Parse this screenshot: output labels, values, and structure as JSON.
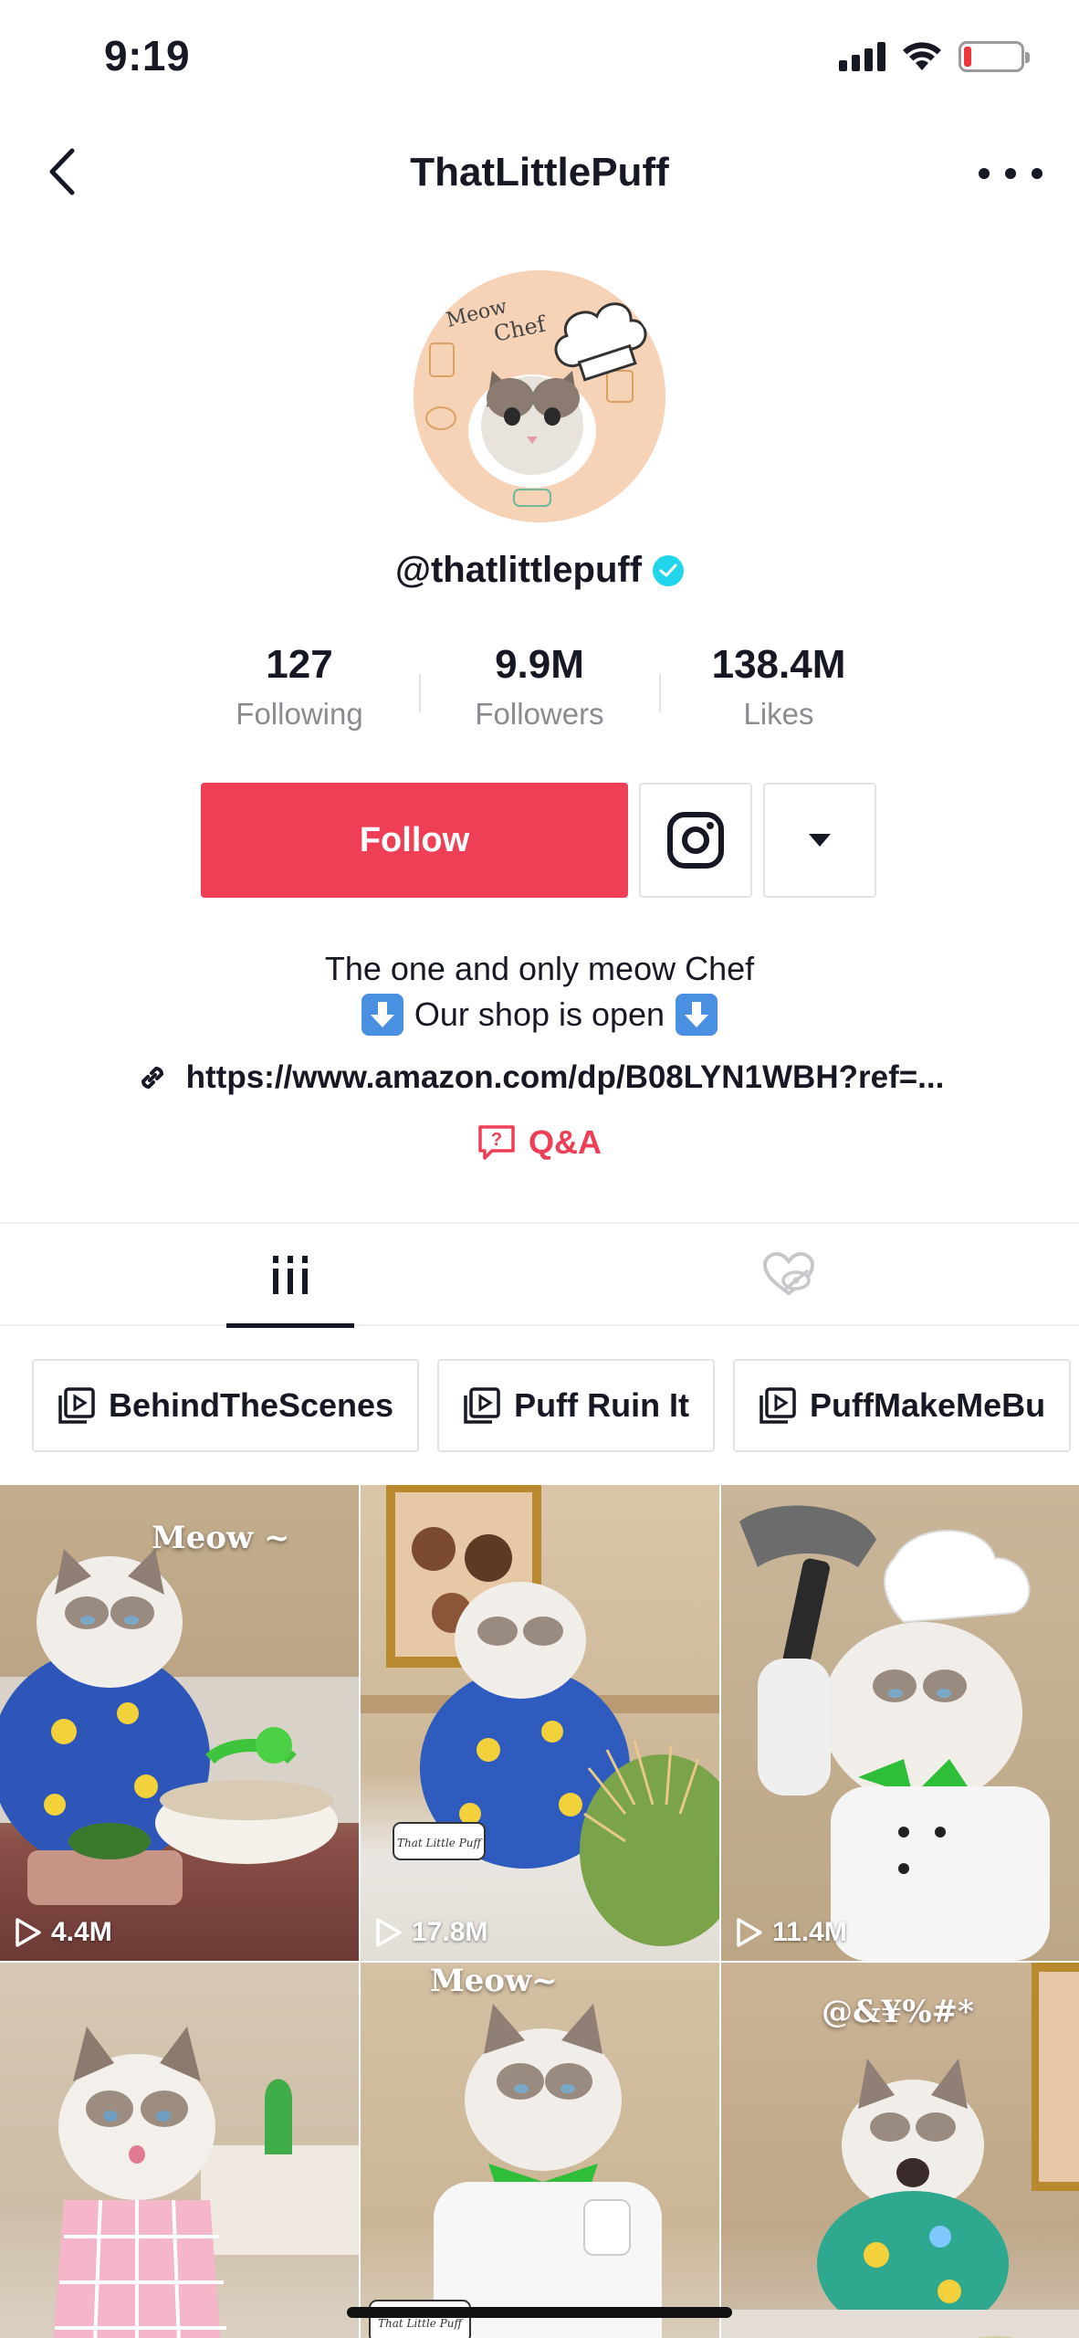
{
  "status_bar": {
    "time": "9:19",
    "battery_color": "#f0363d"
  },
  "header": {
    "title": "ThatLittlePuff",
    "back_icon": "chevron-left-icon",
    "more_icon": "more-dots-icon"
  },
  "profile": {
    "handle": "@thatlittlepuff",
    "verified": true,
    "avatar_lettering": "Meow Chef",
    "stats": [
      {
        "value": "127",
        "label": "Following"
      },
      {
        "value": "9.9M",
        "label": "Followers"
      },
      {
        "value": "138.4M",
        "label": "Likes"
      }
    ]
  },
  "actions": {
    "follow_label": "Follow",
    "follow_color": "#ee3f57",
    "instagram_icon": "instagram-icon",
    "dropdown_icon": "caret-down-icon"
  },
  "bio": {
    "line1": "The one and only meow Chef",
    "line2": "Our shop is open",
    "link": "https://www.amazon.com/dp/B08LYN1WBH?ref=...",
    "qa_label": "Q&A"
  },
  "tabs": [
    {
      "icon": "grid-icon",
      "active": true
    },
    {
      "icon": "liked-hidden-icon",
      "active": false
    }
  ],
  "playlists": [
    {
      "label": "BehindTheScenes"
    },
    {
      "label": "Puff Ruin It"
    },
    {
      "label": "PuffMakeMeBu"
    }
  ],
  "videos": [
    {
      "views": "4.4M",
      "caption": "Meow ~"
    },
    {
      "views": "17.8M",
      "caption": ""
    },
    {
      "views": "11.4M",
      "caption": ""
    },
    {
      "views": "",
      "caption": ""
    },
    {
      "views": "",
      "caption": "Meow~"
    },
    {
      "views": "",
      "caption": "@&¥%#*"
    }
  ]
}
